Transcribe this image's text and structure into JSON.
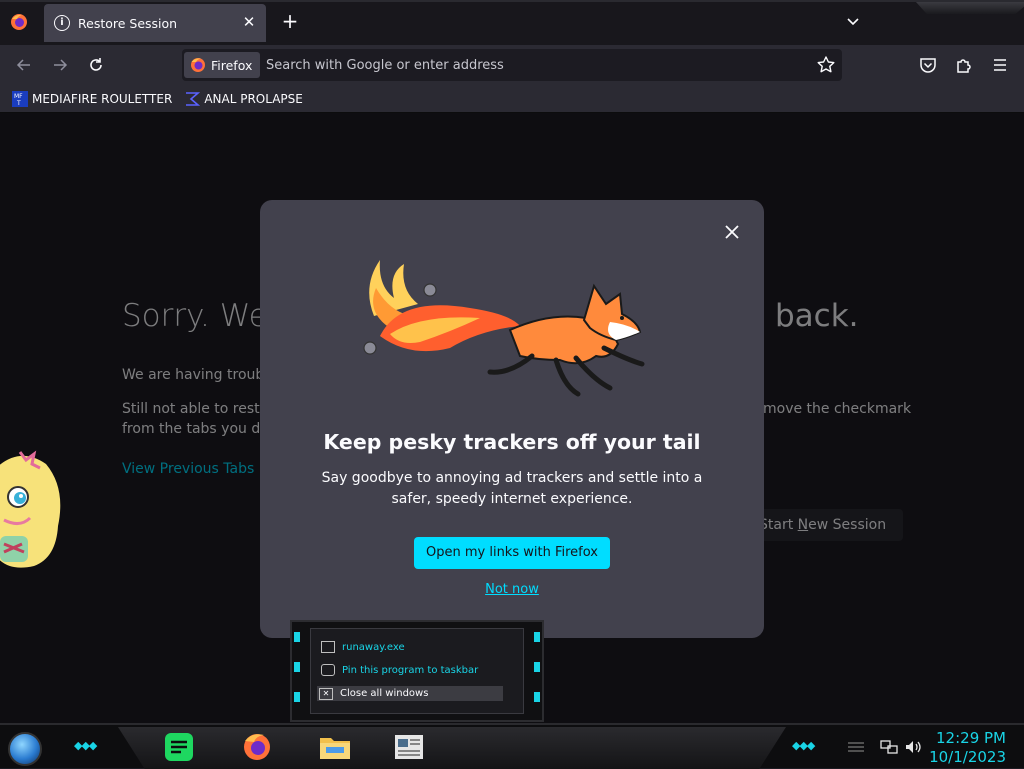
{
  "tabs": [
    {
      "title": "Restore Session",
      "icon": "info-icon"
    }
  ],
  "toolbar": {
    "back_icon": "back-arrow-icon",
    "forward_icon": "forward-arrow-icon",
    "reload_icon": "reload-icon",
    "identity_label": "Firefox",
    "url_placeholder": "Search with Google or enter address",
    "url_value": ""
  },
  "bookmarks": [
    {
      "label": "MEDIAFIRE ROULETTER",
      "icon": "mediafire-icon"
    },
    {
      "label": "ANAL PROLAPSE",
      "icon": "sigma-icon"
    }
  ],
  "page": {
    "heading_left": "Sorry. We’",
    "heading_right": "back.",
    "line1": "We are having troubl",
    "line2a": "Still not able to resto",
    "line2b": "from the tabs you do",
    "line2_right": "move the checkmark",
    "view_link": "View Previous Tabs",
    "start_new_prefix": "Start ",
    "start_new_underlined": "N",
    "start_new_suffix": "ew Session"
  },
  "modal": {
    "title": "Keep pesky trackers off your tail",
    "body": "Say goodbye to annoying ad trackers and settle into a safer, speedy internet experience.",
    "primary_label": "Open my links with Firefox",
    "secondary_label": "Not now"
  },
  "jumplist": {
    "items": [
      {
        "label": "runaway.exe",
        "icon": "window-icon"
      },
      {
        "label": "Pin this program to taskbar",
        "icon": "pin-icon"
      },
      {
        "label": "Close all windows",
        "icon": "close-icon"
      }
    ]
  },
  "taskbar": {
    "time": "12:29 PM",
    "date": "10/1/2023"
  },
  "colors": {
    "accent": "#00ddff",
    "panel": "#42414d",
    "toolbar": "#2b2a33",
    "page_bg": "#1c1b22"
  }
}
